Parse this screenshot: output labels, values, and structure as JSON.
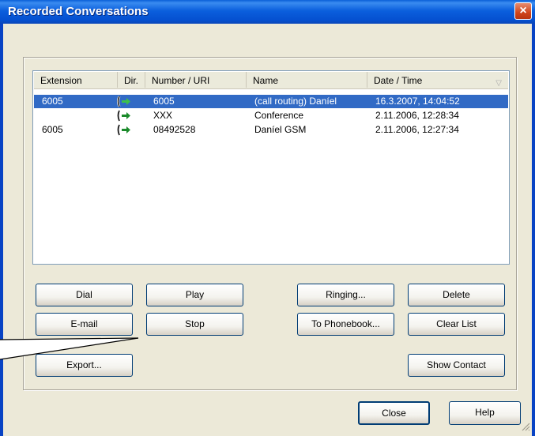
{
  "window": {
    "title": "Recorded Conversations",
    "close_glyph": "×"
  },
  "list": {
    "columns": [
      "Extension",
      "Dir.",
      "Number / URI",
      "Name",
      "Date / Time"
    ],
    "sort_indicator": "▽",
    "rows": [
      {
        "extension": "6005",
        "direction_icon": "outgoing-call-icon",
        "number": "6005",
        "name": "(call routing) Daníel",
        "datetime": "16.3.2007, 14:04:52",
        "selected": true
      },
      {
        "extension": "",
        "direction_icon": "outgoing-call-icon",
        "number": "XXX",
        "name": "Conference",
        "datetime": "2.11.2006, 12:28:34",
        "selected": false
      },
      {
        "extension": "6005",
        "direction_icon": "outgoing-call-icon",
        "number": "08492528",
        "name": "Daníel GSM",
        "datetime": "2.11.2006, 12:27:34",
        "selected": false
      }
    ]
  },
  "buttons": {
    "dial": "Dial",
    "play": "Play",
    "ringing": "Ringing...",
    "delete": "Delete",
    "email": "E-mail",
    "stop": "Stop",
    "to_phonebook": "To Phonebook...",
    "clear_list": "Clear List",
    "export": "Export...",
    "show_contact": "Show Contact",
    "close": "Close",
    "help": "Help"
  },
  "colors": {
    "selection": "#316ac5",
    "titlebar": "#0a5fd8",
    "arrow_green": "#1a8a2a"
  }
}
